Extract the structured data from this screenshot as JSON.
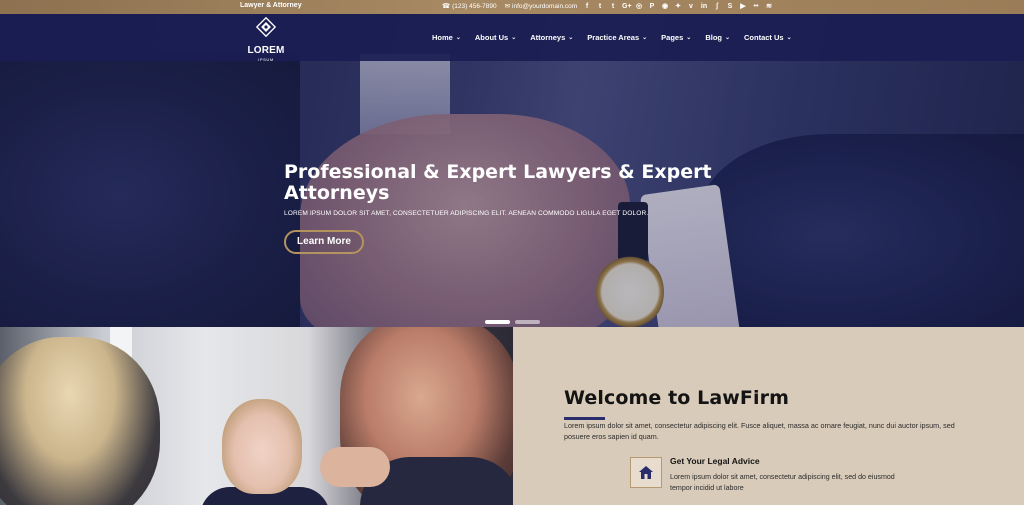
{
  "topbar": {
    "tagline": "Lawyer & Attorney",
    "phone": "(123) 456-7890",
    "email": "info@yourdomain.com",
    "social_icons": [
      "facebook-icon",
      "twitter-icon",
      "tumblr-icon",
      "google-plus-icon",
      "instagram-icon",
      "pinterest-icon",
      "dribbble-icon",
      "flickr-icon",
      "vimeo-icon",
      "linkedin-icon",
      "stumbleupon-icon",
      "skype-icon",
      "youtube-icon",
      "flickr-dots-icon",
      "rss-icon"
    ],
    "social_glyphs": [
      "f",
      "t",
      "t",
      "G+",
      "◎",
      "P",
      "◉",
      "✦",
      "v",
      "in",
      "ʃ",
      "S",
      "▶",
      "••",
      "≋"
    ]
  },
  "header": {
    "logo_word": "LOREM",
    "logo_sub": "IPSUM",
    "nav": [
      {
        "label": "Home"
      },
      {
        "label": "About Us"
      },
      {
        "label": "Attorneys"
      },
      {
        "label": "Practice Areas"
      },
      {
        "label": "Pages"
      },
      {
        "label": "Blog"
      },
      {
        "label": "Contact Us"
      }
    ]
  },
  "hero": {
    "title": "Professional & Expert Lawyers & Expert Attorneys",
    "subtitle": "LOREM IPSUM DOLOR SIT AMET, CONSECTETUER ADIPISCING ELIT. AENEAN COMMODO LIGULA EGET DOLOR.",
    "button_label": "Learn More",
    "slides": 2,
    "active_slide": 1
  },
  "welcome": {
    "title": "Welcome to LawFirm",
    "intro": "Lorem ipsum dolor sit amet, consectetur adipiscing elit. Fusce aliquet, massa ac ornare feugiat, nunc dui auctor ipsum, sed posuere eros sapien id quam.",
    "feature": {
      "icon": "house-icon",
      "title": "Get Your Legal Advice",
      "text": "Lorem ipsum dolor sit amet, consectetur adipiscing elit, sed do eiusmod tempor incidid ut labore"
    }
  },
  "colors": {
    "topbar": "#9a7d58",
    "header": "#1a1d52",
    "accent_gold": "#b4935f",
    "welcome_bg": "#d9cbb9",
    "rule": "#2a2d6b"
  }
}
